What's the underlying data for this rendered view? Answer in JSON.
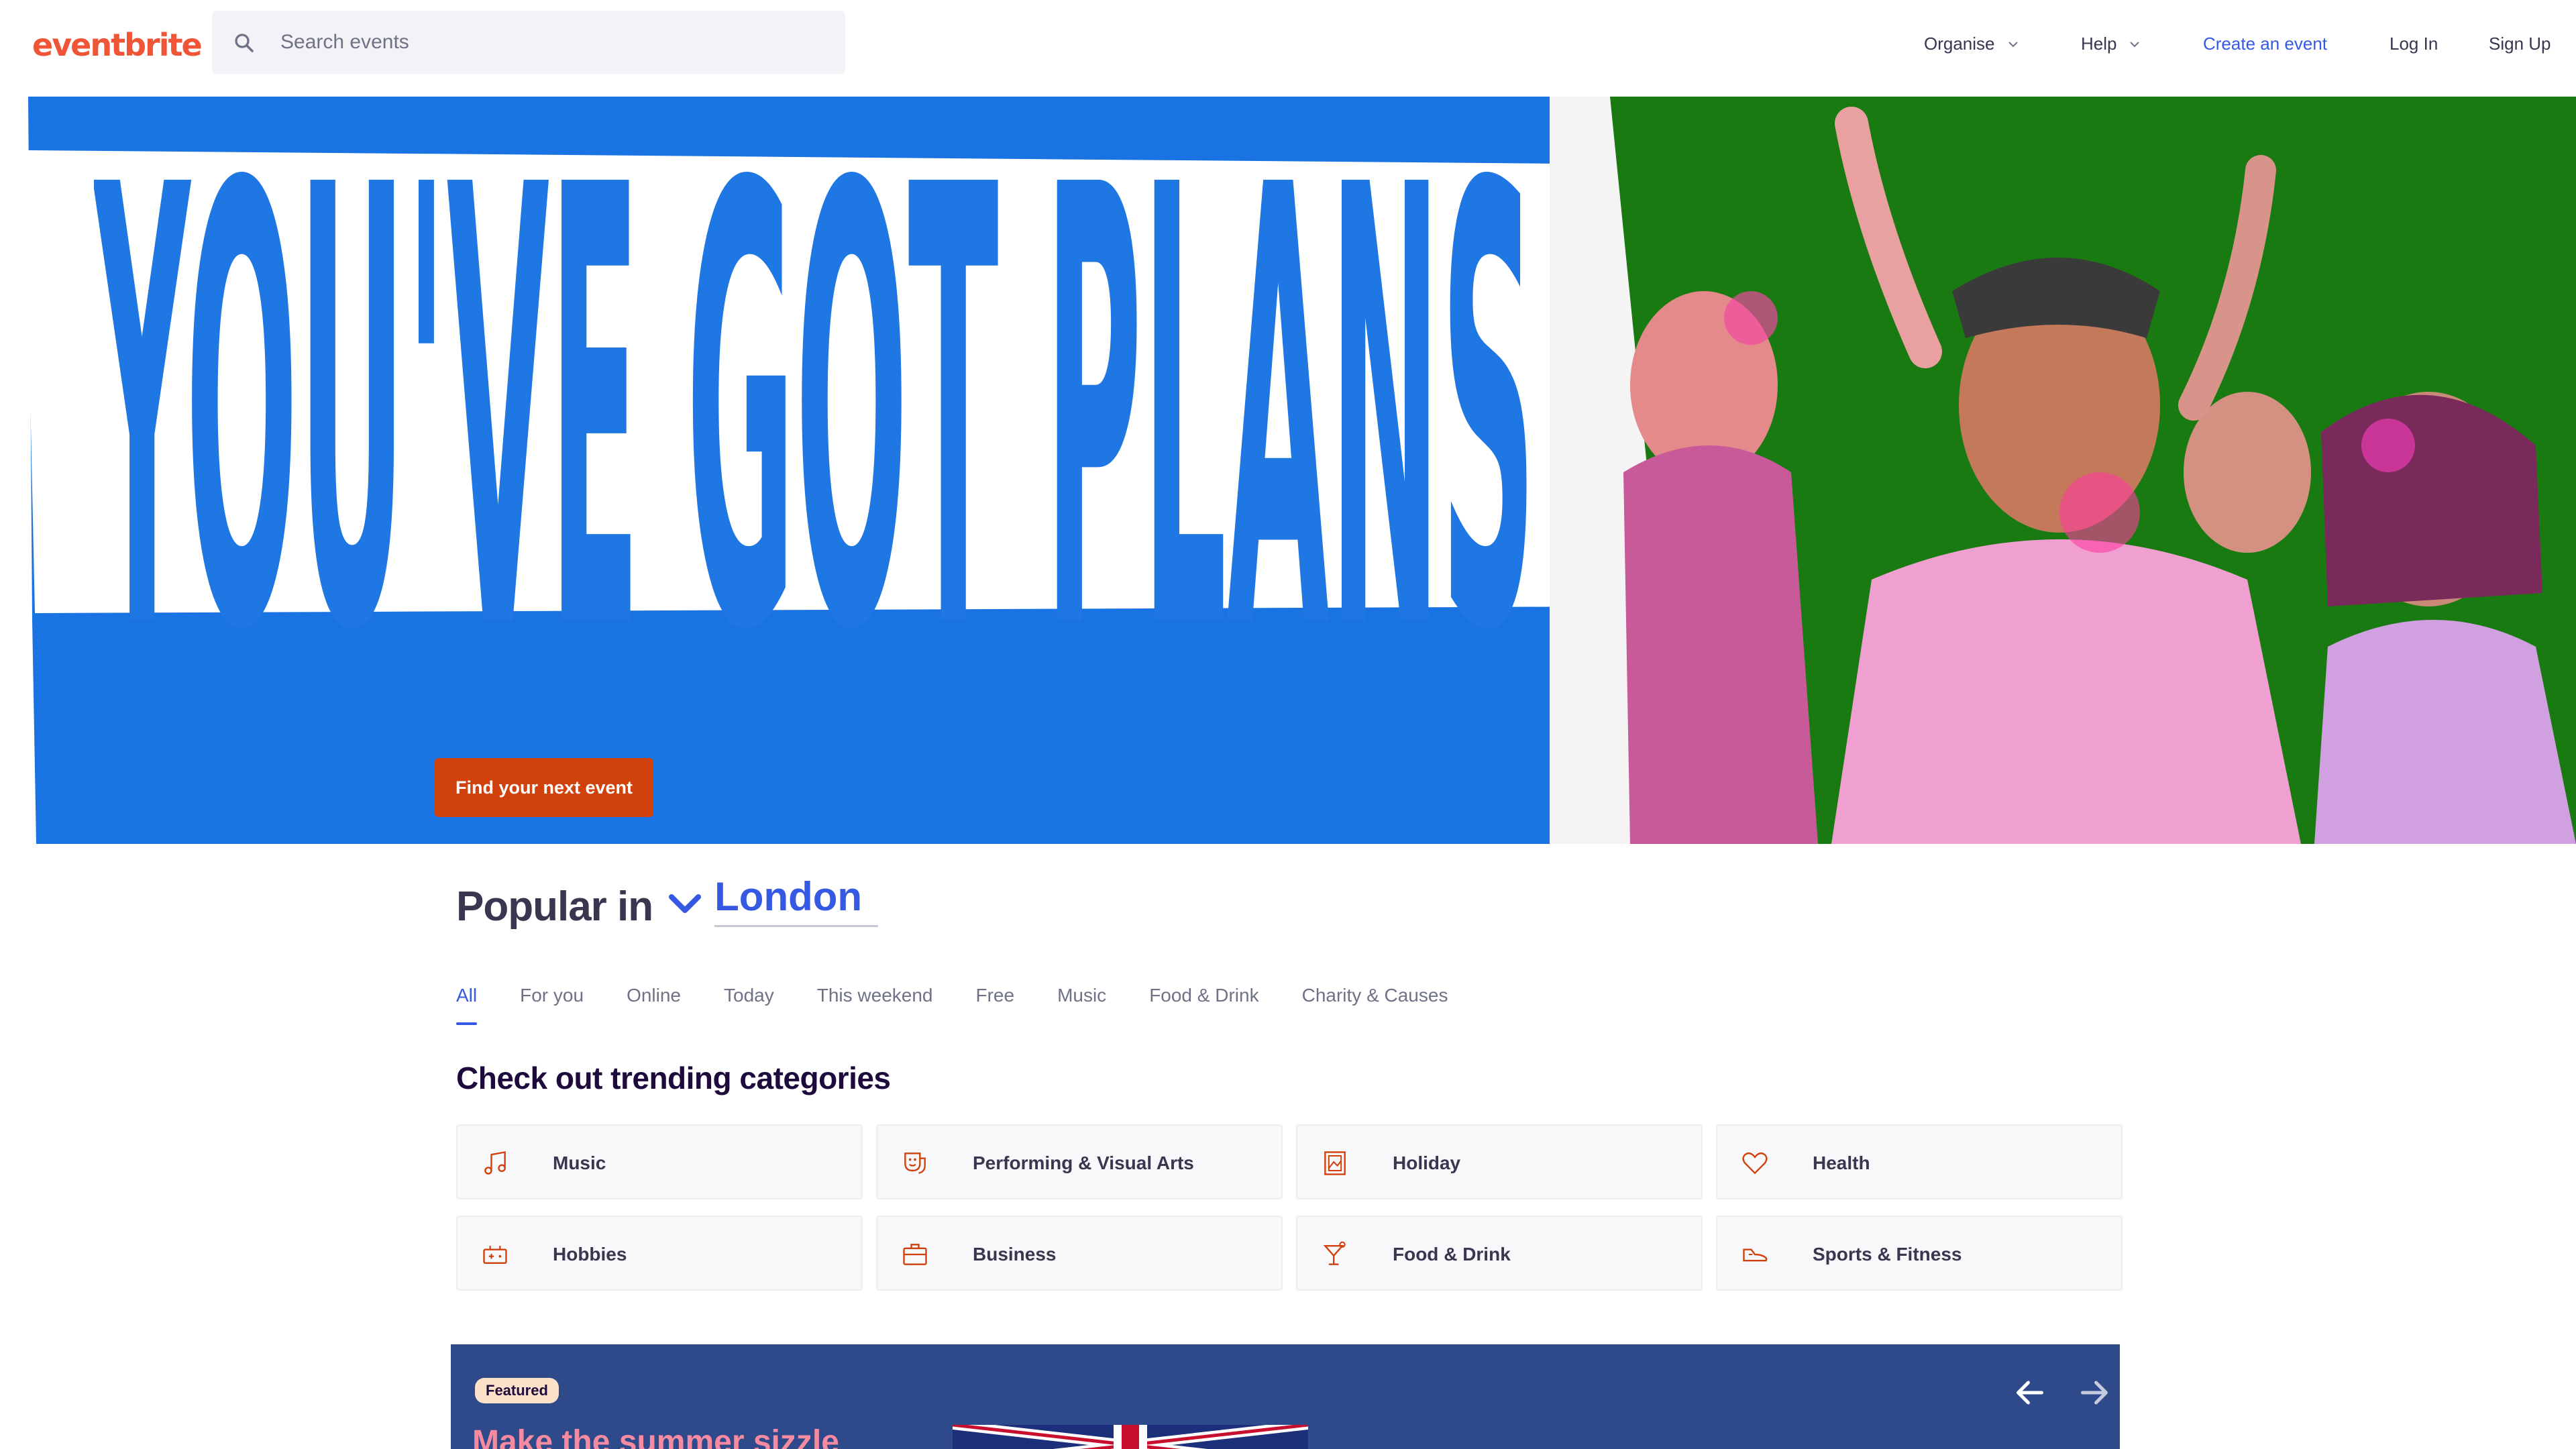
{
  "brand": {
    "logo_text": "eventbrite",
    "accent": "#f05537",
    "link_blue": "#3659e3",
    "cta_color": "#d1410c"
  },
  "search": {
    "placeholder": "Search events"
  },
  "nav": {
    "organise": "Organise",
    "help": "Help",
    "create_event": "Create an event",
    "login": "Log In",
    "signup": "Sign Up"
  },
  "hero": {
    "headline": "YOU'VE GOT PLANS",
    "cta": "Find your next event",
    "headline_color": "#1f77e3"
  },
  "popular": {
    "label": "Popular in",
    "location": "London"
  },
  "tabs": [
    {
      "label": "All",
      "active": true
    },
    {
      "label": "For you"
    },
    {
      "label": "Online"
    },
    {
      "label": "Today"
    },
    {
      "label": "This weekend"
    },
    {
      "label": "Free"
    },
    {
      "label": "Music"
    },
    {
      "label": "Food & Drink"
    },
    {
      "label": "Charity & Causes"
    }
  ],
  "trending": {
    "title": "Check out trending categories",
    "categories": [
      {
        "label": "Music",
        "icon": "music-note-icon"
      },
      {
        "label": "Performing & Visual Arts",
        "icon": "theatre-mask-icon"
      },
      {
        "label": "Holiday",
        "icon": "picture-frame-icon"
      },
      {
        "label": "Health",
        "icon": "heart-icon"
      },
      {
        "label": "Hobbies",
        "icon": "game-controller-icon"
      },
      {
        "label": "Business",
        "icon": "briefcase-icon"
      },
      {
        "label": "Food & Drink",
        "icon": "cocktail-icon"
      },
      {
        "label": "Sports & Fitness",
        "icon": "sneaker-icon"
      }
    ]
  },
  "featured": {
    "badge": "Featured",
    "title": "Make the summer sizzle"
  }
}
